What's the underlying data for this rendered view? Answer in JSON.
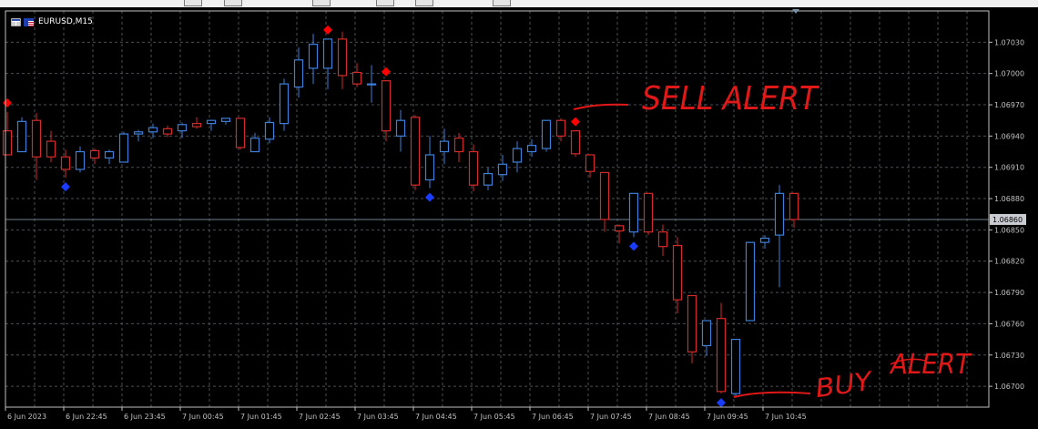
{
  "window": {
    "symbol_label": "EURUSD,M15",
    "current_price_label": "1.06860"
  },
  "annotations": {
    "sell_alert": "SELL ALERT",
    "buy_alert_word1": "BUY",
    "buy_alert_word2": "ALERT"
  },
  "colors": {
    "background": "#000000",
    "grid": "#4a4f55",
    "axis": "#c0c0c0",
    "bull": "#3d7fd9",
    "bear": "#d42a2a",
    "sell_marker": "#ff0000",
    "buy_marker": "#1a3cff",
    "annotation": "#e01818",
    "bid_line": "#6f7f8f"
  },
  "chart_data": {
    "type": "candlestick",
    "symbol": "EURUSD",
    "timeframe": "M15",
    "ylim": [
      1.0668,
      1.0706
    ],
    "y_ticks": [
      1.0703,
      1.07,
      1.0697,
      1.0694,
      1.0691,
      1.0688,
      1.0685,
      1.0682,
      1.0679,
      1.0676,
      1.0673,
      1.067
    ],
    "y_tick_labels": [
      "1.07030",
      "1.07000",
      "1.06970",
      "1.06940",
      "1.06910",
      "1.06880",
      "1.06850",
      "1.06820",
      "1.06790",
      "1.06760",
      "1.06730",
      "1.06700"
    ],
    "x_tick_labels": [
      "6 Jun 2023",
      "6 Jun 22:45",
      "6 Jun 23:45",
      "7 Jun 00:45",
      "7 Jun 01:45",
      "7 Jun 02:45",
      "7 Jun 03:45",
      "7 Jun 04:45",
      "7 Jun 05:45",
      "7 Jun 06:45",
      "7 Jun 07:45",
      "7 Jun 08:45",
      "7 Jun 09:45",
      "7 Jun 10:45"
    ],
    "current_price": 1.0686,
    "candles": [
      {
        "o": 1.06945,
        "h": 1.06963,
        "l": 1.06922,
        "c": 1.06922
      },
      {
        "o": 1.06925,
        "h": 1.06958,
        "l": 1.06925,
        "c": 1.06954
      },
      {
        "o": 1.06955,
        "h": 1.06962,
        "l": 1.06898,
        "c": 1.0692
      },
      {
        "o": 1.06935,
        "h": 1.06945,
        "l": 1.06915,
        "c": 1.0692
      },
      {
        "o": 1.0692,
        "h": 1.06927,
        "l": 1.069,
        "c": 1.06908
      },
      {
        "o": 1.06908,
        "h": 1.0693,
        "l": 1.06905,
        "c": 1.06925
      },
      {
        "o": 1.06926,
        "h": 1.06928,
        "l": 1.06913,
        "c": 1.06919
      },
      {
        "o": 1.06919,
        "h": 1.06927,
        "l": 1.06913,
        "c": 1.06925
      },
      {
        "o": 1.06915,
        "h": 1.06944,
        "l": 1.06915,
        "c": 1.06942
      },
      {
        "o": 1.06942,
        "h": 1.06946,
        "l": 1.06935,
        "c": 1.06944
      },
      {
        "o": 1.06944,
        "h": 1.06952,
        "l": 1.06938,
        "c": 1.06948
      },
      {
        "o": 1.06947,
        "h": 1.0695,
        "l": 1.06939,
        "c": 1.06942
      },
      {
        "o": 1.06945,
        "h": 1.06953,
        "l": 1.06938,
        "c": 1.06951
      },
      {
        "o": 1.06952,
        "h": 1.06958,
        "l": 1.06947,
        "c": 1.06949
      },
      {
        "o": 1.06952,
        "h": 1.06955,
        "l": 1.06945,
        "c": 1.06955
      },
      {
        "o": 1.06954,
        "h": 1.06957,
        "l": 1.06951,
        "c": 1.06957
      },
      {
        "o": 1.06957,
        "h": 1.06957,
        "l": 1.06927,
        "c": 1.06929
      },
      {
        "o": 1.06925,
        "h": 1.06943,
        "l": 1.06925,
        "c": 1.06938
      },
      {
        "o": 1.06937,
        "h": 1.06958,
        "l": 1.06933,
        "c": 1.06953
      },
      {
        "o": 1.06952,
        "h": 1.06995,
        "l": 1.06945,
        "c": 1.0699
      },
      {
        "o": 1.06987,
        "h": 1.07025,
        "l": 1.06977,
        "c": 1.07013
      },
      {
        "o": 1.07005,
        "h": 1.07038,
        "l": 1.0699,
        "c": 1.07028
      },
      {
        "o": 1.07005,
        "h": 1.07033,
        "l": 1.06985,
        "c": 1.07033
      },
      {
        "o": 1.07033,
        "h": 1.0704,
        "l": 1.06985,
        "c": 1.06998
      },
      {
        "o": 1.07001,
        "h": 1.0701,
        "l": 1.06987,
        "c": 1.0699
      },
      {
        "o": 1.0699,
        "h": 1.07008,
        "l": 1.06972,
        "c": 1.0699
      },
      {
        "o": 1.06993,
        "h": 1.06993,
        "l": 1.06935,
        "c": 1.06945
      },
      {
        "o": 1.0694,
        "h": 1.06965,
        "l": 1.06925,
        "c": 1.06955
      },
      {
        "o": 1.06958,
        "h": 1.0696,
        "l": 1.06888,
        "c": 1.06893
      },
      {
        "o": 1.06898,
        "h": 1.0694,
        "l": 1.0689,
        "c": 1.06922
      },
      {
        "o": 1.06925,
        "h": 1.06947,
        "l": 1.06913,
        "c": 1.06935
      },
      {
        "o": 1.06938,
        "h": 1.06943,
        "l": 1.06915,
        "c": 1.06925
      },
      {
        "o": 1.06925,
        "h": 1.06932,
        "l": 1.06887,
        "c": 1.06893
      },
      {
        "o": 1.06893,
        "h": 1.0691,
        "l": 1.06888,
        "c": 1.06904
      },
      {
        "o": 1.06903,
        "h": 1.06922,
        "l": 1.06897,
        "c": 1.06913
      },
      {
        "o": 1.06915,
        "h": 1.06935,
        "l": 1.06905,
        "c": 1.06928
      },
      {
        "o": 1.06925,
        "h": 1.06937,
        "l": 1.0692,
        "c": 1.06931
      },
      {
        "o": 1.06928,
        "h": 1.06955,
        "l": 1.06925,
        "c": 1.06955
      },
      {
        "o": 1.06955,
        "h": 1.06957,
        "l": 1.06935,
        "c": 1.0694
      },
      {
        "o": 1.06945,
        "h": 1.06945,
        "l": 1.0692,
        "c": 1.06923
      },
      {
        "o": 1.06922,
        "h": 1.06922,
        "l": 1.069,
        "c": 1.06906
      },
      {
        "o": 1.06905,
        "h": 1.06905,
        "l": 1.06848,
        "c": 1.0686
      },
      {
        "o": 1.06854,
        "h": 1.06855,
        "l": 1.06837,
        "c": 1.06849
      },
      {
        "o": 1.06848,
        "h": 1.06885,
        "l": 1.06843,
        "c": 1.06885
      },
      {
        "o": 1.06885,
        "h": 1.06885,
        "l": 1.06845,
        "c": 1.06848
      },
      {
        "o": 1.06848,
        "h": 1.06855,
        "l": 1.06825,
        "c": 1.06834
      },
      {
        "o": 1.06835,
        "h": 1.06843,
        "l": 1.0677,
        "c": 1.06783
      },
      {
        "o": 1.06787,
        "h": 1.06787,
        "l": 1.06722,
        "c": 1.06733
      },
      {
        "o": 1.06739,
        "h": 1.06763,
        "l": 1.06729,
        "c": 1.06763
      },
      {
        "o": 1.06765,
        "h": 1.0678,
        "l": 1.06693,
        "c": 1.06695
      },
      {
        "o": 1.06693,
        "h": 1.06745,
        "l": 1.0669,
        "c": 1.06745
      },
      {
        "o": 1.06763,
        "h": 1.06838,
        "l": 1.06763,
        "c": 1.06838
      },
      {
        "o": 1.06838,
        "h": 1.06845,
        "l": 1.06832,
        "c": 1.06842
      },
      {
        "o": 1.06845,
        "h": 1.06893,
        "l": 1.06795,
        "c": 1.06885
      },
      {
        "o": 1.06885,
        "h": 1.06885,
        "l": 1.06852,
        "c": 1.0686
      }
    ],
    "sell_signals": [
      0,
      22,
      26,
      39
    ],
    "buy_signals": [
      4,
      29,
      43,
      49
    ]
  }
}
